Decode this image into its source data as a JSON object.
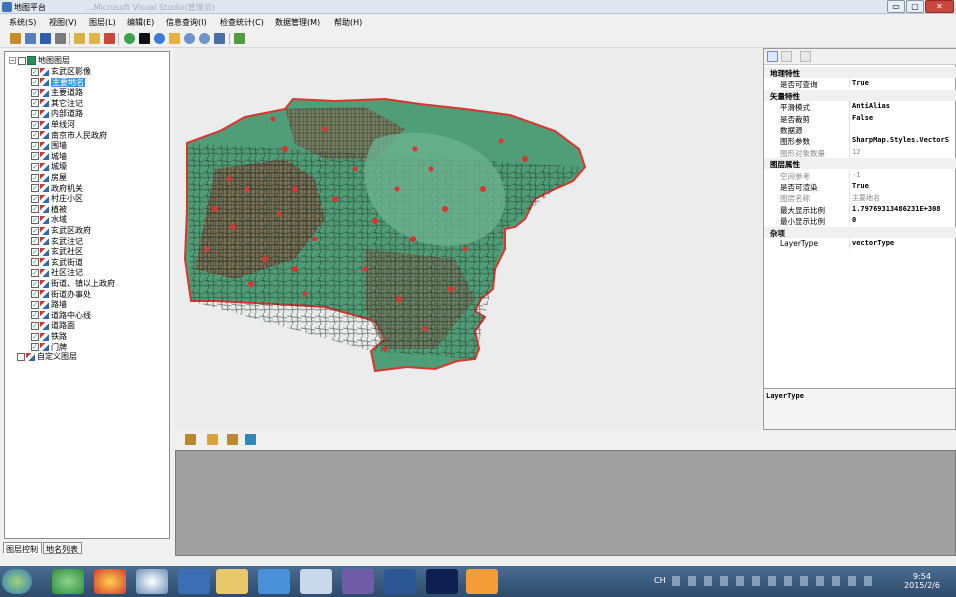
{
  "window": {
    "title": "地图平台",
    "blurred_suffix": "...Microsoft Visual Studio(管理员)",
    "btn_min": "▭",
    "btn_max": "▢",
    "btn_close": "✕"
  },
  "menu": [
    "系统(S)",
    "视图(V)",
    "图层(L)",
    "编辑(E)",
    "信息查询(I)",
    "检查统计(C)",
    "数据管理(M)",
    "帮助(H)"
  ],
  "tree": {
    "root": "地图图层",
    "selected": "主要地名",
    "layers": [
      "玄武区影像",
      "主要地名",
      "主要道路",
      "其它注记",
      "内部道路",
      "单线河",
      "南京市人民政府",
      "围墙",
      "城墙",
      "城壕",
      "房屋",
      "政府机关",
      "村庄小区",
      "植被",
      "水域",
      "玄武区政府",
      "玄武注记",
      "玄武社区",
      "玄武街道",
      "社区注记",
      "街道、镇以上政府",
      "街道办事处",
      "路墙",
      "道路中心线",
      "道路面",
      "铁路",
      "门牌"
    ],
    "custom": "自定义图层"
  },
  "tabs": {
    "layer_control": "图层控制",
    "place_list": "地名列表"
  },
  "properties": {
    "categories": [
      {
        "name": "地理特性",
        "rows": [
          {
            "name": "是否可查询",
            "value": "True",
            "grey": false
          }
        ]
      },
      {
        "name": "矢量特性",
        "rows": [
          {
            "name": "平滑模式",
            "value": "AntiAlias",
            "grey": false
          },
          {
            "name": "是否裁剪",
            "value": "False",
            "grey": false
          },
          {
            "name": "数据源",
            "value": "",
            "grey": false
          },
          {
            "name": "图形参数",
            "value": "SharpMap.Styles.VectorS",
            "grey": false
          },
          {
            "name": "图形对象数量",
            "value": "12",
            "grey": true
          }
        ]
      },
      {
        "name": "图层属性",
        "rows": [
          {
            "name": "空间参考",
            "value": "-1",
            "grey": true
          },
          {
            "name": "是否可渲染",
            "value": "True",
            "grey": false
          },
          {
            "name": "图层名称",
            "value": "主要地名",
            "grey": true
          },
          {
            "name": "最大显示比例",
            "value": "1.79769313486231E+308",
            "grey": false
          },
          {
            "name": "最小显示比例",
            "value": "0",
            "grey": false
          }
        ]
      },
      {
        "name": "杂项",
        "rows": [
          {
            "name": "LayerType",
            "value": "vectorType",
            "grey": false
          }
        ]
      }
    ],
    "description_title": "LayerType"
  },
  "taskbar": {
    "lang": "CH",
    "time": "9:54",
    "date": "2015/2/6"
  },
  "colors": {
    "map_fill": "#4f9e78",
    "map_road": "#1f2e25",
    "map_point": "#d9362e",
    "selection": "#3399ff"
  }
}
